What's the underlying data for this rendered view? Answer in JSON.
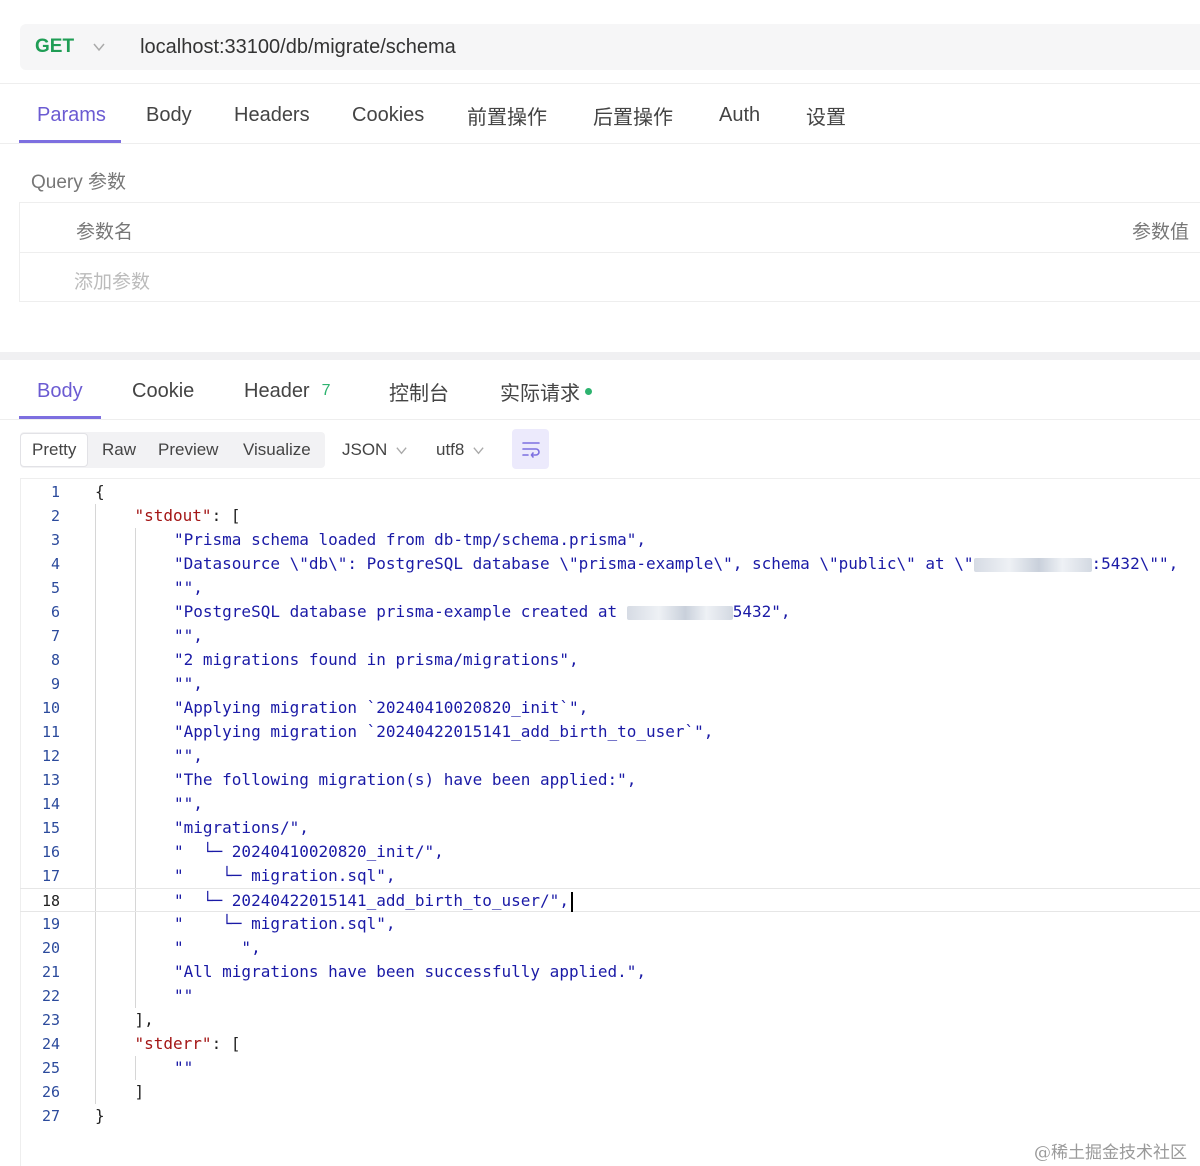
{
  "request": {
    "method": "GET",
    "url": "localhost:33100/db/migrate/schema"
  },
  "request_tabs": [
    {
      "label": "Params",
      "active": true
    },
    {
      "label": "Body",
      "active": false
    },
    {
      "label": "Headers",
      "active": false
    },
    {
      "label": "Cookies",
      "active": false
    },
    {
      "label": "前置操作",
      "active": false
    },
    {
      "label": "后置操作",
      "active": false
    },
    {
      "label": "Auth",
      "active": false
    },
    {
      "label": "设置",
      "active": false
    }
  ],
  "params": {
    "section_label": "Query 参数",
    "name_header": "参数名",
    "value_header": "参数值",
    "add_placeholder": "添加参数"
  },
  "response_tabs": [
    {
      "label": "Body",
      "active": true
    },
    {
      "label": "Cookie",
      "active": false
    },
    {
      "label": "Header",
      "count": "7",
      "active": false
    },
    {
      "label": "控制台",
      "active": false
    },
    {
      "label": "实际请求",
      "status_dot": "green",
      "active": false
    }
  ],
  "view_modes": [
    {
      "label": "Pretty",
      "active": true
    },
    {
      "label": "Raw",
      "active": false
    },
    {
      "label": "Preview",
      "active": false
    },
    {
      "label": "Visualize",
      "active": false
    }
  ],
  "format_select": "JSON",
  "encoding_select": "utf8",
  "wrap_icon": "wrap-lines-icon",
  "colors": {
    "accent": "#6b5bd2",
    "method": "#1f9d55",
    "string": "#1a1aa6",
    "key": "#a31515",
    "line_number": "#2b4a9c"
  },
  "code": {
    "lines": [
      {
        "n": "1",
        "text": "{"
      },
      {
        "n": "2",
        "key": "\"stdout\"",
        "text": ": ["
      },
      {
        "n": "3",
        "text": "\"Prisma schema loaded from db-tmp/schema.prisma\","
      },
      {
        "n": "4",
        "text": "\"Datasource \\\"db\\\": PostgreSQL database \\\"prisma-example\\\", schema \\\"public\\\" at \\\"",
        "redact_width": 118,
        "tail": ":5432\\\"\","
      },
      {
        "n": "5",
        "text": "\"\","
      },
      {
        "n": "6",
        "text": "\"PostgreSQL database prisma-example created at ",
        "redact_width": 106,
        "tail": "5432\","
      },
      {
        "n": "7",
        "text": "\"\","
      },
      {
        "n": "8",
        "text": "\"2 migrations found in prisma/migrations\","
      },
      {
        "n": "9",
        "text": "\"\","
      },
      {
        "n": "10",
        "text": "\"Applying migration `20240410020820_init`\","
      },
      {
        "n": "11",
        "text": "\"Applying migration `20240422015141_add_birth_to_user`\","
      },
      {
        "n": "12",
        "text": "\"\","
      },
      {
        "n": "13",
        "text": "\"The following migration(s) have been applied:\","
      },
      {
        "n": "14",
        "text": "\"\","
      },
      {
        "n": "15",
        "text": "\"migrations/\","
      },
      {
        "n": "16",
        "text": "\"  └─ 20240410020820_init/\","
      },
      {
        "n": "17",
        "text": "\"    └─ migration.sql\","
      },
      {
        "n": "18",
        "text": "\"  └─ 20240422015141_add_birth_to_user/\",",
        "current": true
      },
      {
        "n": "19",
        "text": "\"    └─ migration.sql\","
      },
      {
        "n": "20",
        "text": "\"      \","
      },
      {
        "n": "21",
        "text": "\"All migrations have been successfully applied.\","
      },
      {
        "n": "22",
        "text": "\"\""
      },
      {
        "n": "23",
        "text": "],"
      },
      {
        "n": "24",
        "key": "\"stderr\"",
        "text": ": ["
      },
      {
        "n": "25",
        "text": "\"\""
      },
      {
        "n": "26",
        "text": "]"
      },
      {
        "n": "27",
        "text": "}"
      }
    ]
  },
  "watermark": "@稀土掘金技术社区"
}
